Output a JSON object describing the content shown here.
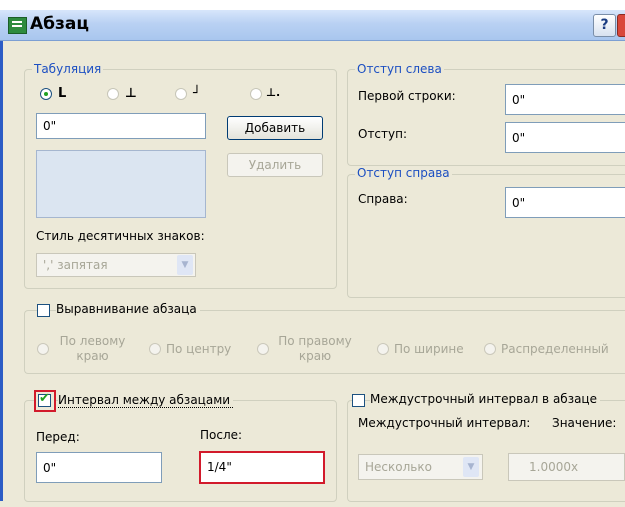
{
  "window": {
    "title": "Абзац",
    "help_label": "?"
  },
  "tabs_group": {
    "title": "Табуляция",
    "tab_stops": [
      "L",
      "⊥",
      "┘",
      "⊥."
    ],
    "input_value": "0\"",
    "add_button": "Добавить",
    "delete_button": "Удалить",
    "decimal_style_label": "Стиль десятичных знаков:",
    "decimal_style_value": "',' запятая"
  },
  "left_indent": {
    "title": "Отступ слева",
    "first_line_label": "Первой строки:",
    "first_line_value": "0\"",
    "indent_label": "Отступ:",
    "indent_value": "0\""
  },
  "right_indent": {
    "title": "Отступ справа",
    "right_label": "Справа:",
    "right_value": "0\""
  },
  "alignment": {
    "label": "Выравнивание абзаца",
    "options": [
      "По левому краю",
      "По центру",
      "По правому краю",
      "По ширине",
      "Распределенный"
    ]
  },
  "spacing": {
    "label": "Интервал между абзацами",
    "checked": true,
    "before_label": "Перед:",
    "before_value": "0\"",
    "after_label": "После:",
    "after_value": "1/4\""
  },
  "line_spacing": {
    "label": "Междустрочный интервал в абзаце",
    "interval_label": "Междустрочный интервал:",
    "value_label": "Значение:",
    "mode_value": "Несколько",
    "value": "1.0000x"
  },
  "colors": {
    "accent": "#1c4fc2",
    "highlight": "#d21a2b",
    "dialog_bg": "#ece9d8"
  }
}
